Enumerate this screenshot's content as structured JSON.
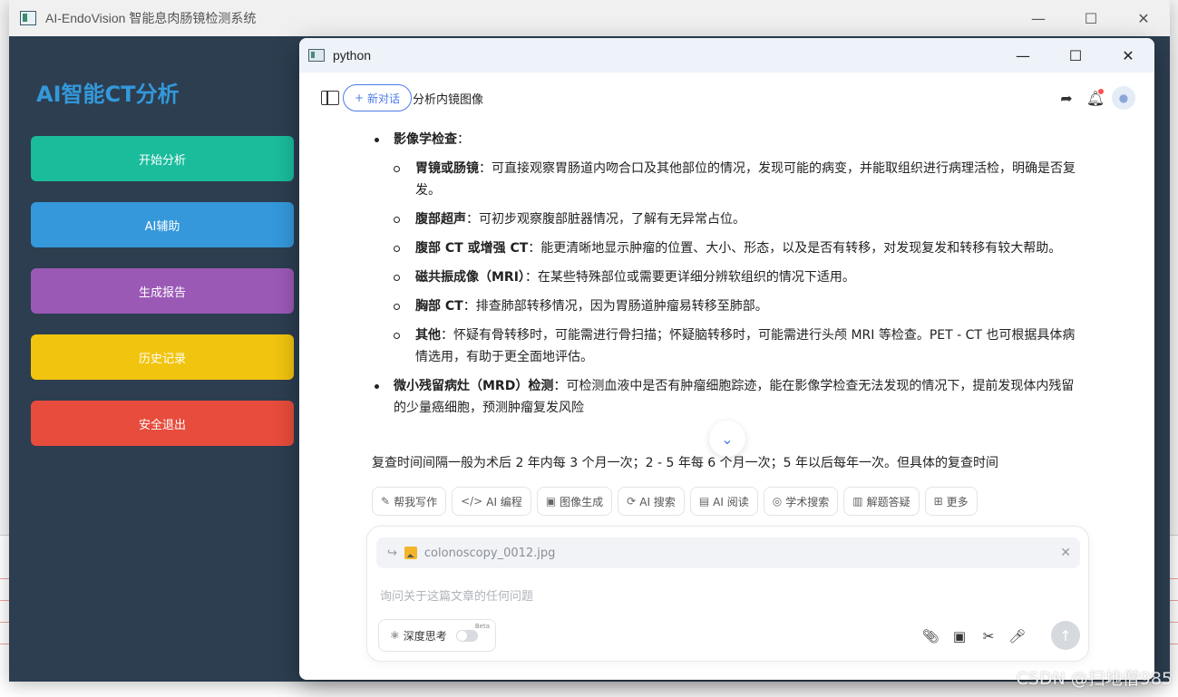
{
  "main_window": {
    "title": "AI-EndoVision 智能息肉肠镜检测系统",
    "controls": {
      "minimize": "—",
      "maximize": "☐",
      "close": "✕"
    }
  },
  "sidebar": {
    "brand": "AI智能CT分析",
    "buttons": [
      {
        "label": "开始分析",
        "color": "#1abc9c"
      },
      {
        "label": "AI辅助",
        "color": "#3498db"
      },
      {
        "label": "生成报告",
        "color": "#9b59b6"
      },
      {
        "label": "历史记录",
        "color": "#f1c40f"
      },
      {
        "label": "安全退出",
        "color": "#e74c3c"
      }
    ]
  },
  "chat_window": {
    "title": "python",
    "controls": {
      "minimize": "—",
      "maximize": "☐",
      "close": "✕"
    },
    "new_chat": "新对话",
    "conversation_title": "分析内镜图像"
  },
  "content": {
    "imaging": {
      "title": "影像学检查",
      "items": [
        {
          "term": "胃镜或肠镜",
          "text": "：可直接观察胃肠道内吻合口及其他部位的情况，发现可能的病变，并能取组织进行病理活检，明确是否复发。"
        },
        {
          "term": "腹部超声",
          "text": "：可初步观察腹部脏器情况，了解有无异常占位。"
        },
        {
          "term": "腹部 CT 或增强 CT",
          "text": "：能更清晰地显示肿瘤的位置、大小、形态，以及是否有转移，对发现复发和转移有较大帮助。"
        },
        {
          "term": "磁共振成像（MRI）",
          "text": "：在某些特殊部位或需要更详细分辨软组织的情况下适用。"
        },
        {
          "term": "胸部 CT",
          "text": "：排查肺部转移情况，因为胃肠道肿瘤易转移至肺部。"
        },
        {
          "term": "其他",
          "text": "：怀疑有骨转移时，可能需进行骨扫描；怀疑脑转移时，可能需进行头颅 MRI 等检查。PET - CT 也可根据具体病情选用，有助于更全面地评估。"
        }
      ]
    },
    "mrd": {
      "term": "微小残留病灶（MRD）检测",
      "text": "：可检测血液中是否有肿瘤细胞踪迹，能在影像学检查无法发现的情况下，提前发现体内残留的少量癌细胞，预测肿瘤复发风险"
    },
    "trailing": "复查时间间隔一般为术后 2 年内每 3 个月一次；2 - 5 年每 6 个月一次；5 年以后每年一次。但具体的复查时间"
  },
  "tools": [
    {
      "icon": "✎",
      "label": "帮我写作"
    },
    {
      "icon": "</>",
      "label": "AI 编程"
    },
    {
      "icon": "▣",
      "label": "图像生成"
    },
    {
      "icon": "⟳",
      "label": "AI 搜索"
    },
    {
      "icon": "▤",
      "label": "AI 阅读"
    },
    {
      "icon": "◎",
      "label": "学术搜索"
    },
    {
      "icon": "▥",
      "label": "解题答疑"
    },
    {
      "icon": "⊞",
      "label": "更多"
    }
  ],
  "input": {
    "attachment": "colonoscopy_0012.jpg",
    "placeholder": "询问关于这篇文章的任何问题",
    "deep_think": "深度思考",
    "beta": "Beta"
  },
  "watermark": "CSDN @扫地僧985"
}
